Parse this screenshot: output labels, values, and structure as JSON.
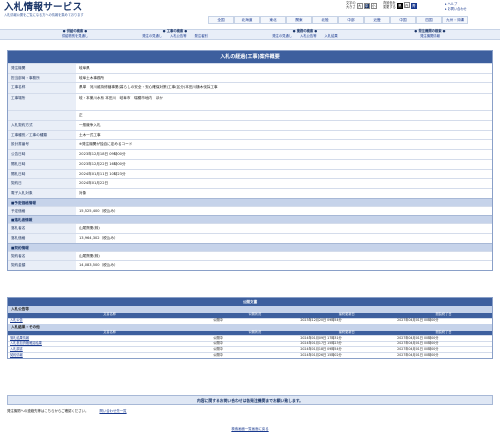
{
  "header": {
    "title": "入札情報サービス",
    "subtitle": "入札情報公開をご覧になる方への情報を集めております"
  },
  "regions": [
    "全国",
    "北海道",
    "東北",
    "関東",
    "北陸",
    "中部",
    "近畿",
    "中国",
    "四国",
    "九州・沖縄"
  ],
  "font_size": {
    "label1": "文字の",
    "label2": "大きさ",
    "large": "大",
    "medium": "中",
    "small": "小"
  },
  "font_color": {
    "label1": "背景色を",
    "label2": "変更する",
    "b1": "黒",
    "b2": "白",
    "b3": "青"
  },
  "help": {
    "h1": "ヘルプ",
    "h2": "お問い合わせ"
  },
  "nav": [
    {
      "title": "● 供給の検索 ●",
      "items": [
        "供給物別を見通し"
      ]
    },
    {
      "title": "● 工事の検索 ●",
      "items": [
        "発注の見通し",
        "入札公告等",
        "発注者別"
      ]
    },
    {
      "title": "● 業務の検索 ●",
      "items": [
        "発注の見通し",
        "入札公告等",
        "入札結果"
      ]
    },
    {
      "title": "● 発注機関の検索 ●",
      "items": [
        "発注機関情報"
      ]
    }
  ],
  "box_title": "入札の経過(工事)案件概要",
  "rows": [
    {
      "label": "発注機関",
      "value": "岐阜県"
    },
    {
      "label": "担当部局・事務所",
      "value": "岐阜土木事務所"
    },
    {
      "label": "工事名称",
      "value": "県単　河川維持修繕事業(暮らしの安全・安心確保対策)工事(区分)本田川樋木伐採工事"
    },
    {
      "label": "工事場所",
      "value": "岐・本巣川水系 本田川　岐阜市　瑞穂市地内　ほか"
    },
    {
      "label": "",
      "value": "正"
    },
    {
      "label": "入札契約方式",
      "value": "一般競争入札"
    },
    {
      "label": "工事種別／工事の種類",
      "value": "土木一式工事"
    },
    {
      "label": "設計書番号",
      "value": "※発注機関が独自に定めるコード"
    },
    {
      "label": "公告日時",
      "value": "2023年12月18日 09時00分"
    },
    {
      "label": "開札日時",
      "value": "2023年12月22日 16時00分"
    },
    {
      "label": "開札日時",
      "value": "2024年01月11日 10時23分"
    },
    {
      "label": "契約日",
      "value": "2024年01月22日"
    },
    {
      "label": "電子入札対象",
      "value": "対象"
    }
  ],
  "sec_price": "■予定価格情報",
  "price_rows": [
    {
      "label": "予定価格",
      "value": "15,525,400（税込み）"
    }
  ],
  "sec_winner": "■落札者情報",
  "winner_rows": [
    {
      "label": "落札者名",
      "value": "山尾興業(株)"
    },
    {
      "label": "落札価格",
      "value": "13,964,302（税込み）"
    }
  ],
  "sec_contract": "■契約情報",
  "contract_rows": [
    {
      "label": "契約者名",
      "value": "山尾興業(株)"
    },
    {
      "label": "契約金額",
      "value": "14,083,500（税込み）"
    }
  ],
  "pub_title": "公開文書",
  "pub_sec1": "入札公告等",
  "pub_headers": [
    "文書名称",
    "公開状況",
    "最終更新日",
    "閲覧終了日"
  ],
  "pub_rows1": [
    [
      "入札公告",
      "公開中",
      "2023年12月20日 09時54分",
      "2027年04月01日 00時00分"
    ]
  ],
  "pub_sec2": "入札結果・その他",
  "pub_rows2": [
    [
      "落札結果情報",
      "公開中",
      "2024年01月09日 17時31分",
      "2027年04月01日 00時00分"
    ],
    [
      "入札参加資格確認結果",
      "公開中",
      "2024年01月17日 15時23分",
      "2027年04月01日 00時00分"
    ],
    [
      "入札調書",
      "公開中",
      "2024年01月18日 09時54分",
      "2027年04月01日 00時00分"
    ],
    [
      "契約情報",
      "公開中",
      "2024年01月26日 15時02分",
      "2027年04月01日 00時00分"
    ]
  ],
  "footer_bar": "内容に関するお問い合わせは各発注機関までお願い致します。",
  "footer_link1": "発注機関への連絡先等はこちらからご確認ください。",
  "footer_link2": "問い合わせ先一覧",
  "footer_bottom": "検索画面一覧画面に戻る"
}
